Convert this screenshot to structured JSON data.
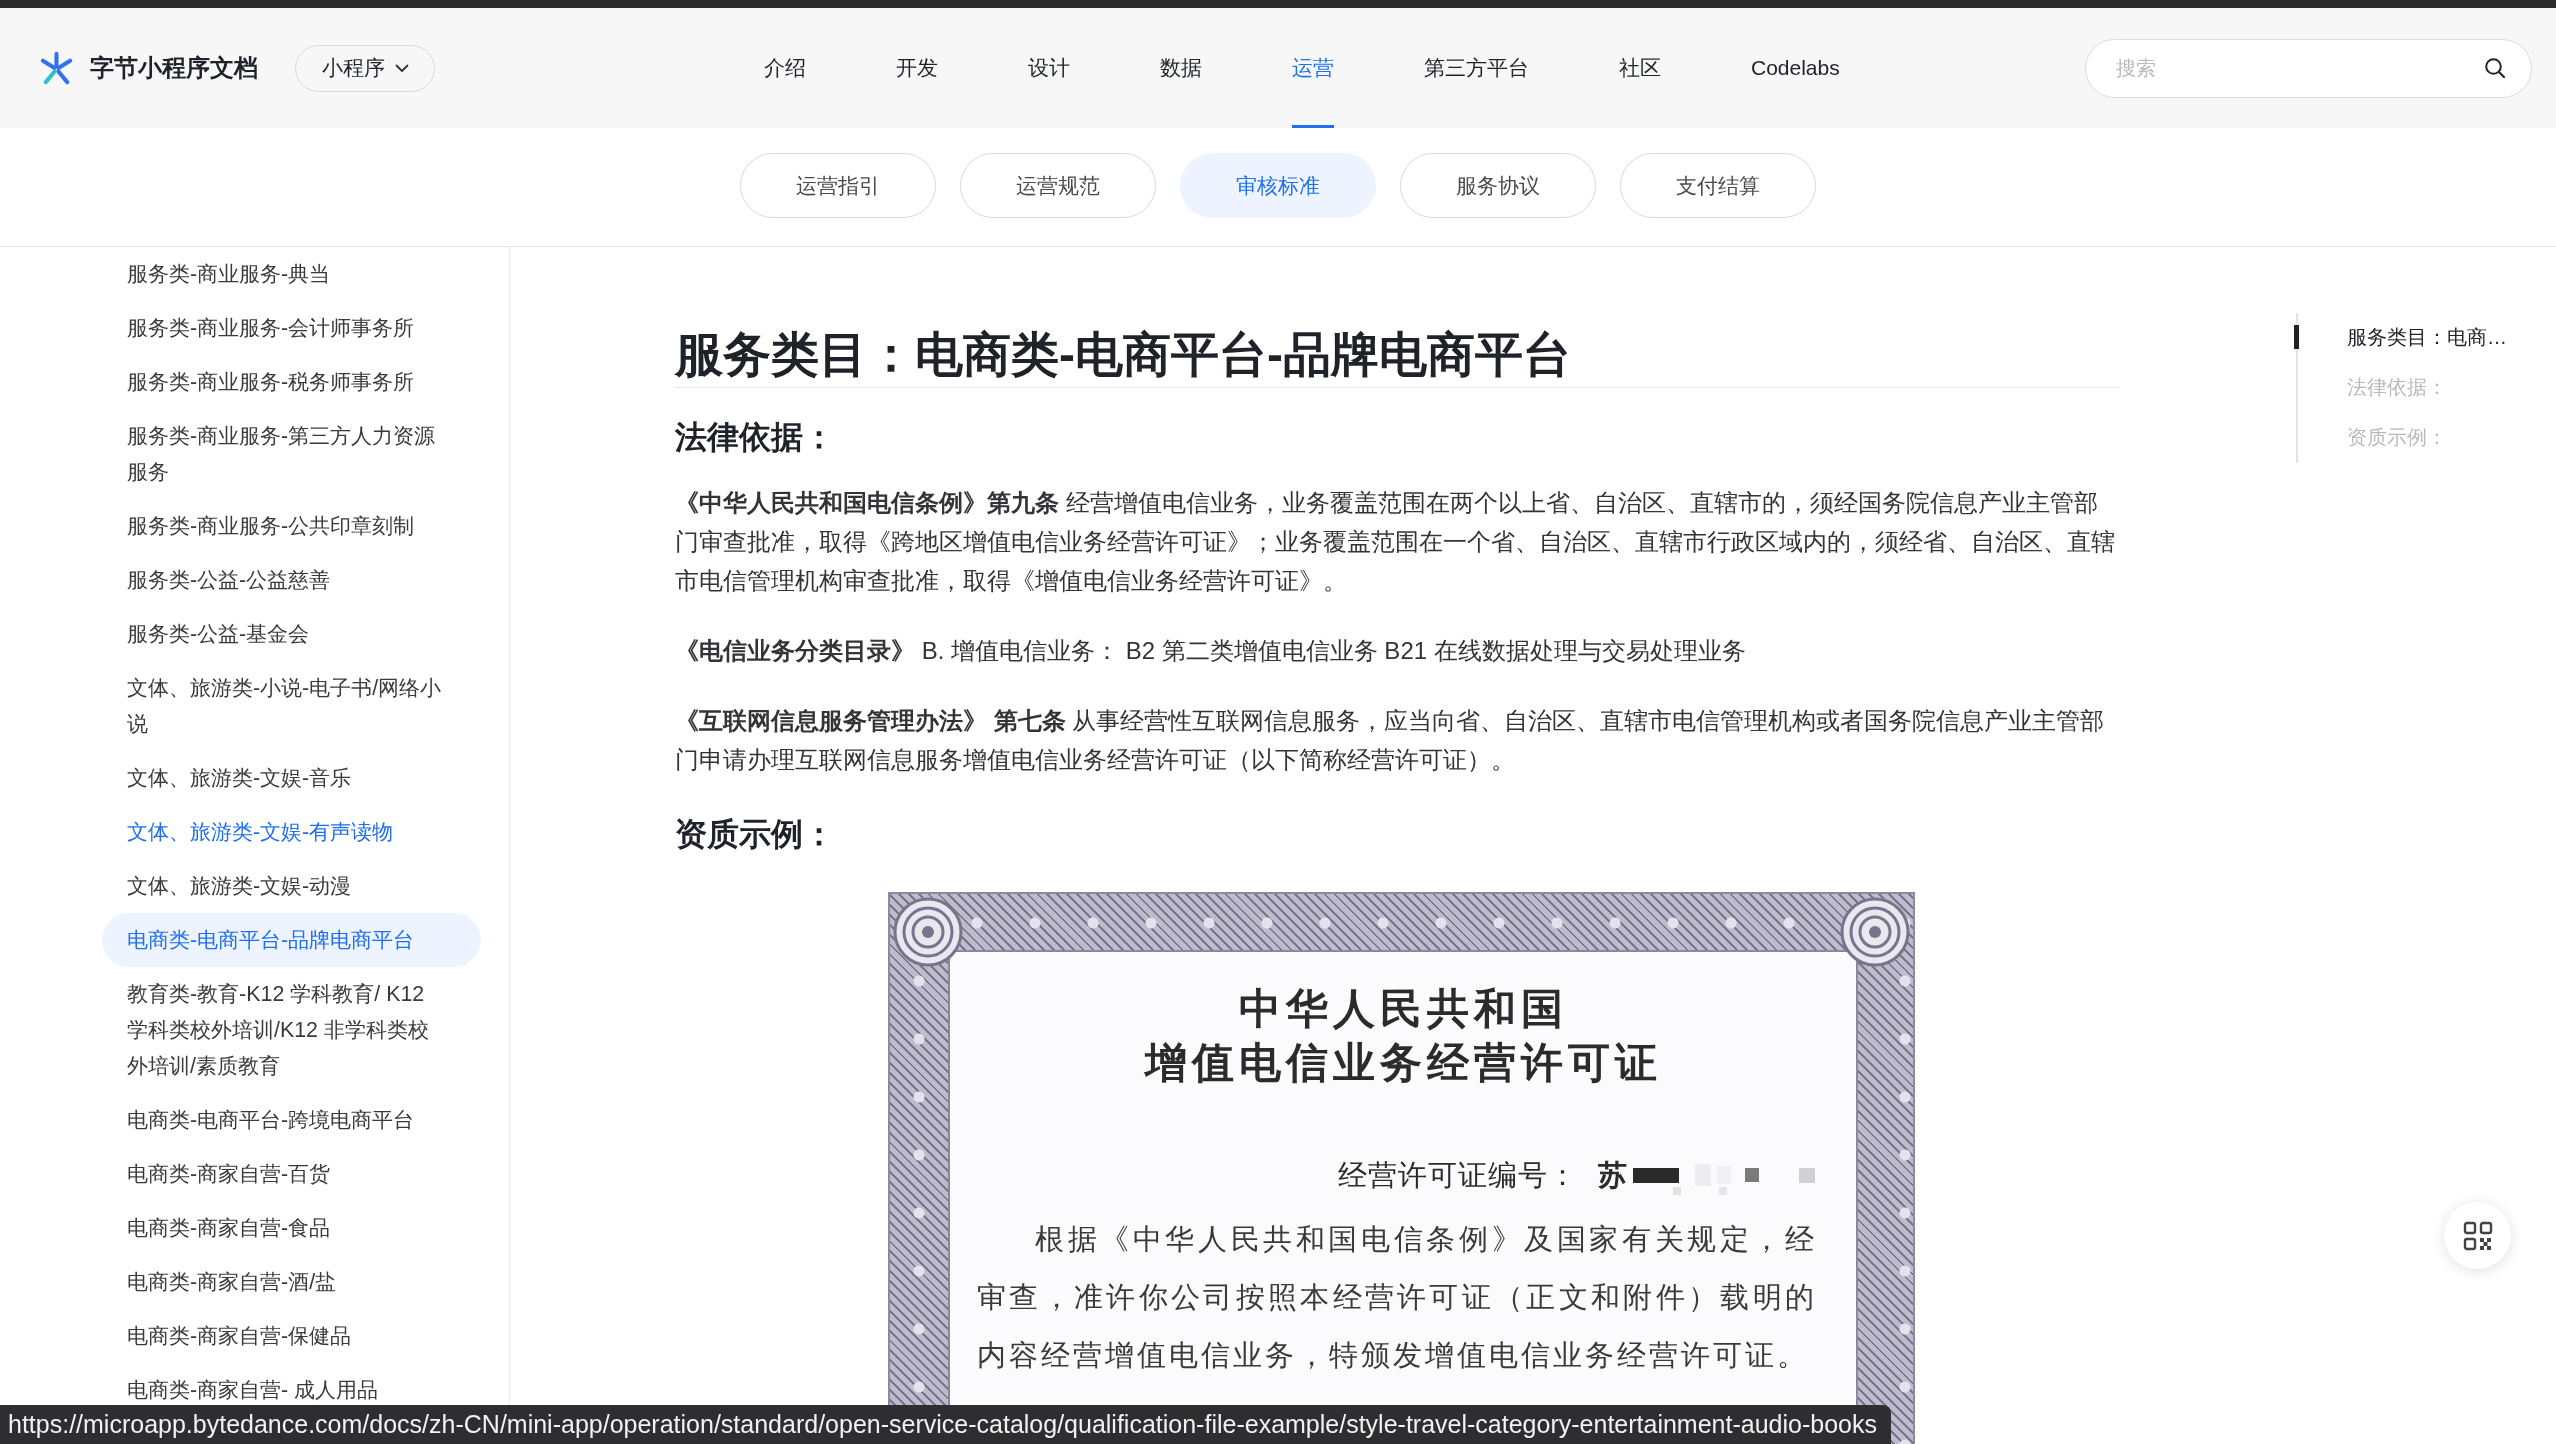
{
  "header": {
    "logo_text": "字节小程序文档",
    "product_dropdown": {
      "label": "小程序"
    },
    "nav": [
      {
        "label": "介绍",
        "selected": false
      },
      {
        "label": "开发",
        "selected": false
      },
      {
        "label": "设计",
        "selected": false
      },
      {
        "label": "数据",
        "selected": false
      },
      {
        "label": "运营",
        "selected": true
      },
      {
        "label": "第三方平台",
        "selected": false
      },
      {
        "label": "社区",
        "selected": false
      },
      {
        "label": "Codelabs",
        "selected": false
      }
    ],
    "search": {
      "placeholder": "搜索"
    }
  },
  "sub_tabs": [
    {
      "label": "运营指引",
      "selected": false
    },
    {
      "label": "运营规范",
      "selected": false
    },
    {
      "label": "审核标准",
      "selected": true
    },
    {
      "label": "服务协议",
      "selected": false
    },
    {
      "label": "支付结算",
      "selected": false
    }
  ],
  "sidebar": {
    "items": [
      {
        "label": "服务类-商业服务-典当",
        "selected": false,
        "hovered": false
      },
      {
        "label": "服务类-商业服务-会计师事务所",
        "selected": false,
        "hovered": false
      },
      {
        "label": "服务类-商业服务-税务师事务所",
        "selected": false,
        "hovered": false
      },
      {
        "label": "服务类-商业服务-第三方人力资源服务",
        "selected": false,
        "hovered": false
      },
      {
        "label": "服务类-商业服务-公共印章刻制",
        "selected": false,
        "hovered": false
      },
      {
        "label": "服务类-公益-公益慈善",
        "selected": false,
        "hovered": false
      },
      {
        "label": "服务类-公益-基金会",
        "selected": false,
        "hovered": false
      },
      {
        "label": "文体、旅游类-小说-电子书/网络小说",
        "selected": false,
        "hovered": false
      },
      {
        "label": "文体、旅游类-文娱-音乐",
        "selected": false,
        "hovered": false
      },
      {
        "label": "文体、旅游类-文娱-有声读物",
        "selected": false,
        "hovered": true
      },
      {
        "label": "文体、旅游类-文娱-动漫",
        "selected": false,
        "hovered": false
      },
      {
        "label": "电商类-电商平台-品牌电商平台",
        "selected": true,
        "hovered": false
      },
      {
        "label": "教育类-教育-K12 学科教育/ K12 学科类校外培训/K12 非学科类校外培训/素质教育",
        "selected": false,
        "hovered": false
      },
      {
        "label": "电商类-电商平台-跨境电商平台",
        "selected": false,
        "hovered": false
      },
      {
        "label": "电商类-商家自营-百货",
        "selected": false,
        "hovered": false
      },
      {
        "label": "电商类-商家自营-食品",
        "selected": false,
        "hovered": false
      },
      {
        "label": "电商类-商家自营-酒/盐",
        "selected": false,
        "hovered": false
      },
      {
        "label": "电商类-商家自营-保健品",
        "selected": false,
        "hovered": false
      },
      {
        "label": "电商类-商家自营- 成人用品",
        "selected": false,
        "hovered": false
      }
    ]
  },
  "article": {
    "title": "服务类目：电商类-电商平台-品牌电商平台",
    "sections": [
      {
        "heading": "法律依据：",
        "blocks": [
          {
            "kind": "paragraph",
            "text": "**《中华人民共和国电信条例》第九条** 经营增值电信业务，业务覆盖范围在两个以上省、自治区、直辖市的，须经国务院信息产业主管部门审查批准，取得《跨地区增值电信业务经营许可证》；业务覆盖范围在一个省、自治区、直辖市行政区域内的，须经省、自治区、直辖市电信管理机构审查批准，取得《增值电信业务经营许可证》。"
          },
          {
            "kind": "paragraph",
            "text": "**《电信业务分类目录》** B. 增值电信业务： B2 第二类增值电信业务 B21 在线数据处理与交易处理业务"
          },
          {
            "kind": "paragraph",
            "text": "**《互联网信息服务管理办法》 第七条** 从事经营性互联网信息服务，应当向省、自治区、直辖市电信管理机构或者国务院信息产业主管部门申请办理互联网信息服务增值电信业务经营许可证（以下简称经营许可证）。"
          }
        ]
      },
      {
        "heading": "资质示例：",
        "blocks": [
          {
            "kind": "certificate",
            "title_lines": [
              "中华人民共和国",
              "增值电信业务经营许可证"
            ],
            "number_label": "经营许可证编号：",
            "number_value": "苏",
            "number_redacted": true,
            "body": "根据《中华人民共和国电信条例》及国家有关规定，经审查，准许你公司按照本经营许可证（正文和附件）载明的内容经营增值电信业务，特颁发增值电信业务经营许可证。"
          }
        ]
      }
    ]
  },
  "toc": {
    "items": [
      {
        "label": "服务类目：电商…",
        "selected": true
      },
      {
        "label": "法律依据：",
        "selected": false
      },
      {
        "label": "资质示例：",
        "selected": false
      }
    ]
  },
  "status_bar": {
    "url": "https://microapp.bytedance.com/docs/zh-CN/mini-app/operation/standard/open-service-catalog/qualification-file-example/style-travel-category-entertainment-audio-books"
  }
}
